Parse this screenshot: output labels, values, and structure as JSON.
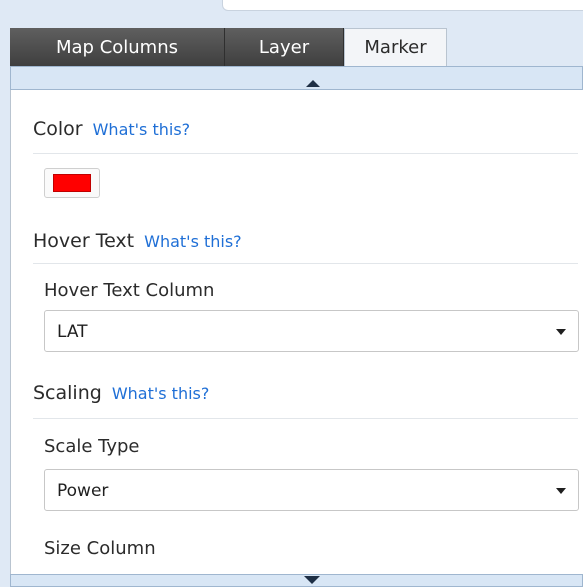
{
  "tabs": [
    {
      "label": "Map Columns",
      "active": false
    },
    {
      "label": "Layer",
      "active": false
    },
    {
      "label": "Marker",
      "active": true
    }
  ],
  "help_link_label": "What's this?",
  "sections": {
    "color": {
      "title": "Color",
      "value": "#ff0000"
    },
    "hover_text": {
      "title": "Hover Text",
      "column_label": "Hover Text Column",
      "column_value": "LAT"
    },
    "scaling": {
      "title": "Scaling",
      "scale_type_label": "Scale Type",
      "scale_type_value": "Power",
      "size_column_label": "Size Column"
    }
  },
  "colors": {
    "accent_link": "#1f6fd6",
    "panel_bg": "#dfe9f5",
    "tab_dark": "#4a4a4a"
  }
}
